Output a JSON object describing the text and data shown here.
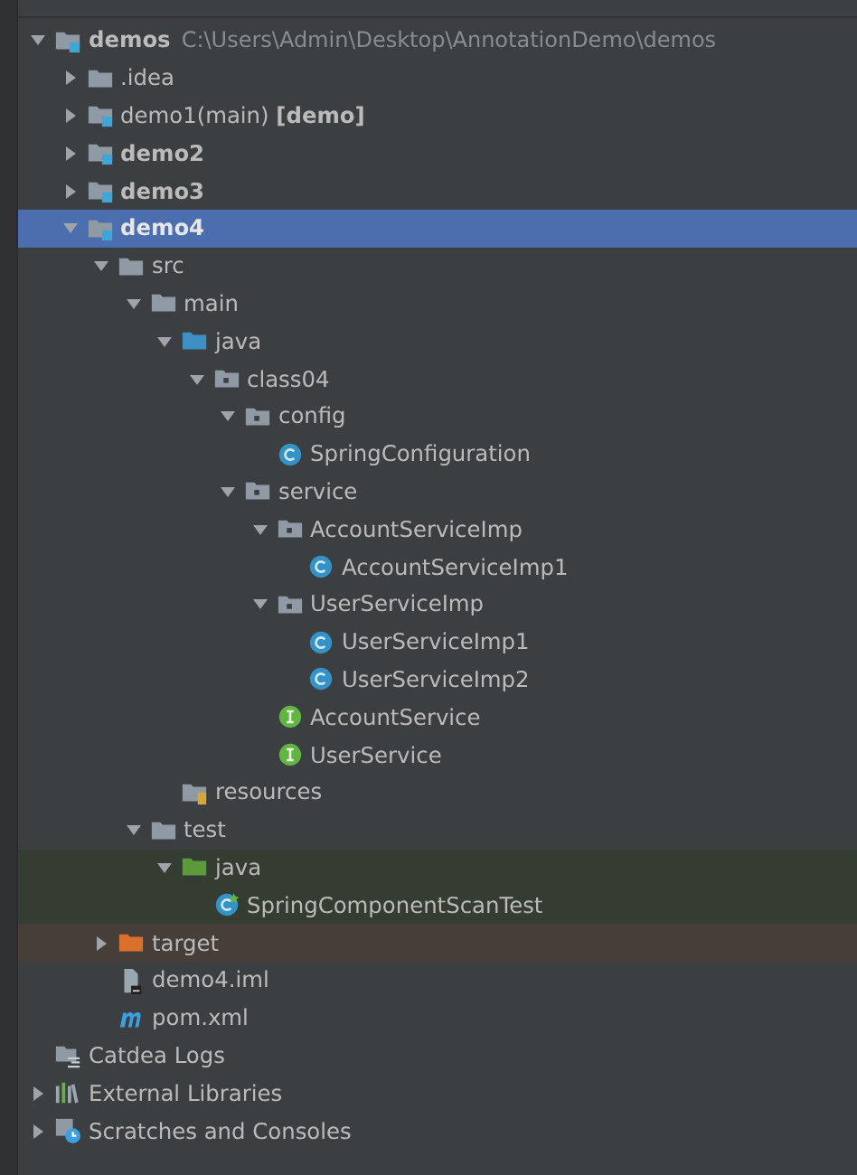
{
  "tree": [
    {
      "label": "demos",
      "kind": "module",
      "bold": true,
      "hint": "C:\\Users\\Admin\\Desktop\\AnnotationDemo\\demos",
      "expanded": true,
      "selected": false,
      "children": [
        {
          "label": ".idea",
          "kind": "folder",
          "expanded": false,
          "selected": false
        },
        {
          "label": "demo1(main) **[demo]**",
          "kind": "module",
          "expanded": false,
          "selected": false
        },
        {
          "label": "demo2",
          "kind": "module",
          "bold": true,
          "expanded": false,
          "selected": false
        },
        {
          "label": "demo3",
          "kind": "module",
          "bold": true,
          "expanded": false,
          "selected": false
        },
        {
          "label": "demo4",
          "kind": "module",
          "bold": true,
          "expanded": true,
          "selected": true,
          "children": [
            {
              "label": "src",
              "kind": "folder",
              "expanded": true,
              "selected": false,
              "children": [
                {
                  "label": "main",
                  "kind": "folder",
                  "expanded": true,
                  "selected": false,
                  "children": [
                    {
                      "label": "java",
                      "kind": "source",
                      "expanded": true,
                      "selected": false,
                      "children": [
                        {
                          "label": "class04",
                          "kind": "package",
                          "expanded": true,
                          "selected": false,
                          "children": [
                            {
                              "label": "config",
                              "kind": "package",
                              "expanded": true,
                              "selected": false,
                              "children": [
                                {
                                  "label": "SpringConfiguration",
                                  "kind": "class",
                                  "selected": false
                                }
                              ]
                            },
                            {
                              "label": "service",
                              "kind": "package",
                              "expanded": true,
                              "selected": false,
                              "children": [
                                {
                                  "label": "AccountServiceImp",
                                  "kind": "package",
                                  "expanded": true,
                                  "selected": false,
                                  "children": [
                                    {
                                      "label": "AccountServiceImp1",
                                      "kind": "class",
                                      "selected": false
                                    }
                                  ]
                                },
                                {
                                  "label": "UserServiceImp",
                                  "kind": "package",
                                  "expanded": true,
                                  "selected": false,
                                  "children": [
                                    {
                                      "label": "UserServiceImp1",
                                      "kind": "class",
                                      "selected": false
                                    },
                                    {
                                      "label": "UserServiceImp2",
                                      "kind": "class",
                                      "selected": false
                                    }
                                  ]
                                },
                                {
                                  "label": "AccountService",
                                  "kind": "interface",
                                  "selected": false
                                },
                                {
                                  "label": "UserService",
                                  "kind": "interface",
                                  "selected": false
                                }
                              ]
                            }
                          ]
                        }
                      ]
                    },
                    {
                      "label": "resources",
                      "kind": "resources",
                      "selected": false
                    }
                  ]
                },
                {
                  "label": "test",
                  "kind": "folder",
                  "expanded": true,
                  "selected": false,
                  "children": [
                    {
                      "label": "java",
                      "kind": "test-source",
                      "tests": true,
                      "expanded": true,
                      "selected": false,
                      "children": [
                        {
                          "label": "SpringComponentScanTest",
                          "kind": "test-class",
                          "tests": true,
                          "selected": false
                        }
                      ]
                    }
                  ]
                }
              ]
            },
            {
              "label": "target",
              "kind": "excluded",
              "excluded": true,
              "expanded": false,
              "selected": false
            },
            {
              "label": "demo4.iml",
              "kind": "iml",
              "selected": false
            },
            {
              "label": "pom.xml",
              "kind": "maven",
              "selected": false
            }
          ]
        }
      ]
    },
    {
      "label": "Catdea Logs",
      "kind": "logs",
      "selected": false
    },
    {
      "label": "External Libraries",
      "kind": "libraries",
      "expanded": false,
      "selected": false
    },
    {
      "label": "Scratches and Consoles",
      "kind": "scratches",
      "expanded": false,
      "selected": false
    }
  ]
}
